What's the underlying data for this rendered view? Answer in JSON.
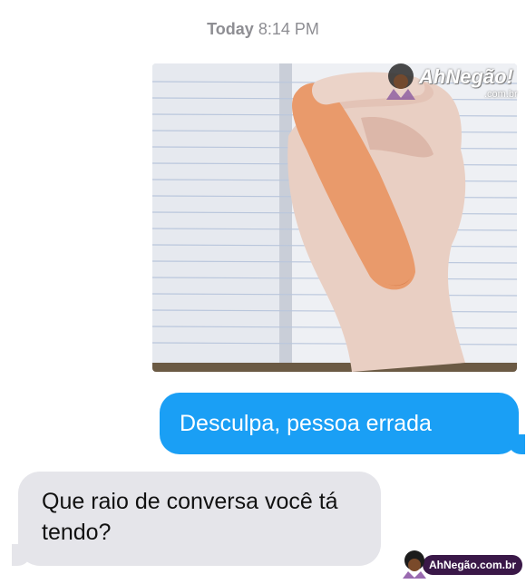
{
  "conversation": {
    "timestamp": {
      "day": "Today",
      "time": "8:14 PM"
    },
    "photo": {
      "watermark": "AhNegão!",
      "watermark_domain": ".com.br"
    },
    "messages": [
      {
        "direction": "sent",
        "text": "Desculpa, pessoa errada"
      },
      {
        "direction": "received",
        "text": "Que raio de conversa você tá tendo?"
      }
    ]
  },
  "footer_watermark": "AhNegão.com.br",
  "colors": {
    "sent_bubble": "#1a9ff5",
    "received_bubble": "#e5e5ea",
    "timestamp": "#8e8e93",
    "watermark_badge": "#3a1848"
  }
}
